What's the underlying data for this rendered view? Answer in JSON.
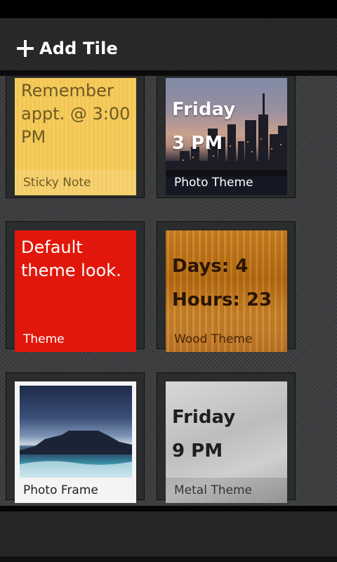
{
  "toolbar": {
    "add_tile_label": "Add Tile"
  },
  "tiles": [
    {
      "text_lines": [
        "Remember",
        "appt. @ 3:00",
        "PM"
      ],
      "label": "Sticky Note"
    },
    {
      "line1": "Friday",
      "line2": "3 PM",
      "label": "Photo Theme"
    },
    {
      "text_lines": [
        "Default",
        "theme look."
      ],
      "label": "Theme"
    },
    {
      "line1": "Days: 4",
      "line2": "Hours: 23",
      "label": "Wood Theme"
    },
    {
      "label": "Photo Frame"
    },
    {
      "line1": "Friday",
      "line2": "9 PM",
      "label": "Metal Theme"
    }
  ]
}
